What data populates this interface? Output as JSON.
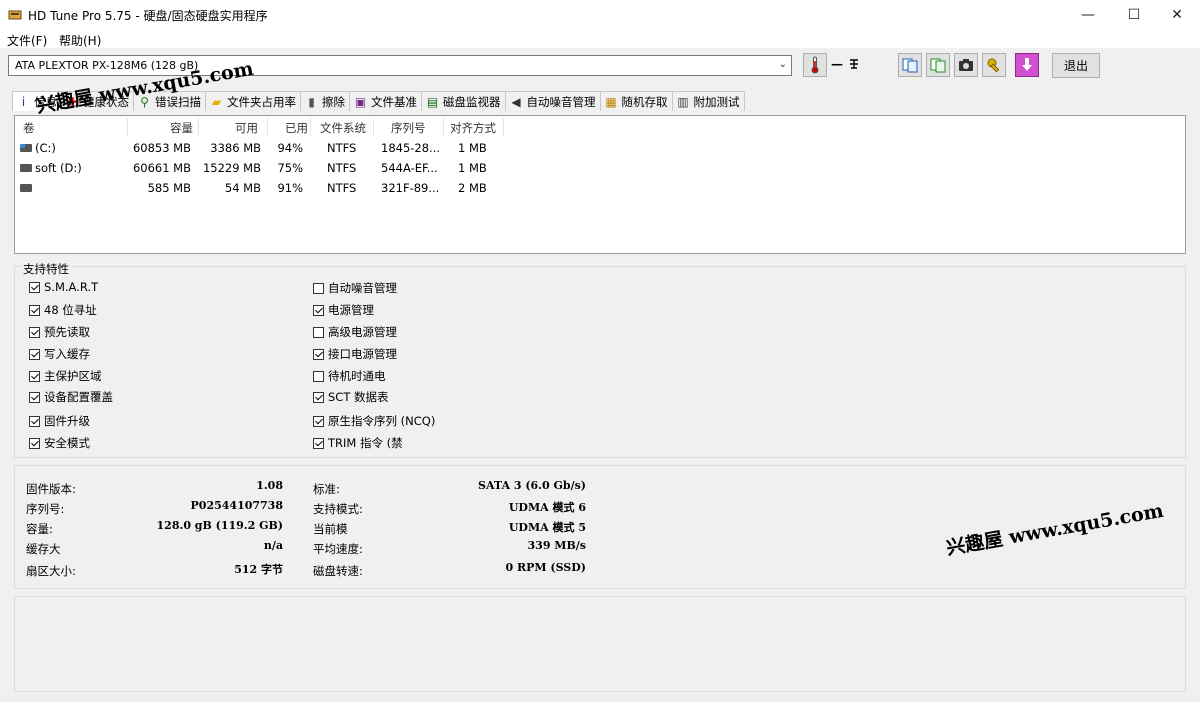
{
  "window": {
    "title": "HD Tune Pro 5.75 - 硬盘/固态硬盘实用程序",
    "min": "—",
    "max": "☐",
    "close": "✕"
  },
  "menu": {
    "file": "文件(F)",
    "help": "帮助(H)"
  },
  "toolbar": {
    "drive": "ATA    PLEXTOR PX-128M6 (128 gB)",
    "temp": "— ",
    "exit": "退出"
  },
  "tabs": [
    {
      "label": "信息",
      "icon": "info-icon"
    },
    {
      "label": "健康状态",
      "icon": "health-cross-icon"
    },
    {
      "label": "错误扫描",
      "icon": "magnifier-icon"
    },
    {
      "label": "文件夹占用率",
      "icon": "folder-icon"
    },
    {
      "label": "擦除",
      "icon": "trash-icon"
    },
    {
      "label": "文件基准",
      "icon": "file-benchmark-icon"
    },
    {
      "label": "磁盘监视器",
      "icon": "disk-monitor-icon"
    },
    {
      "label": "自动噪音管理",
      "icon": "speaker-icon"
    },
    {
      "label": "随机存取",
      "icon": "random-access-icon"
    },
    {
      "label": "附加测试",
      "icon": "extra-tests-icon"
    }
  ],
  "volumes": {
    "headers": [
      "卷",
      "容量",
      "可用",
      "已用",
      "文件系统",
      "序列号",
      "对齐方式"
    ],
    "rows": [
      {
        "name": "(C:)",
        "capacity": "60853 MB",
        "free": "3386 MB",
        "used": "94%",
        "fs": "NTFS",
        "serial": "1845-28...",
        "align": "1 MB"
      },
      {
        "name": "soft (D:)",
        "capacity": "60661 MB",
        "free": "15229 MB",
        "used": "75%",
        "fs": "NTFS",
        "serial": "544A-EF...",
        "align": "1 MB"
      },
      {
        "name": "",
        "capacity": "585 MB",
        "free": "54 MB",
        "used": "91%",
        "fs": "NTFS",
        "serial": "321F-89...",
        "align": "2 MB"
      }
    ]
  },
  "features": {
    "legend": "支持特性",
    "left": [
      {
        "label": "S.M.A.R.T",
        "checked": true
      },
      {
        "label": "48 位寻址",
        "checked": true
      },
      {
        "label": "预先读取",
        "checked": true
      },
      {
        "label": "写入缓存",
        "checked": true
      },
      {
        "label": "主保护区域",
        "checked": true
      },
      {
        "label": "设备配置覆盖",
        "checked": true
      },
      {
        "label": "固件升级",
        "checked": true
      },
      {
        "label": "安全模式",
        "checked": true
      }
    ],
    "right": [
      {
        "label": "自动噪音管理",
        "checked": false
      },
      {
        "label": "电源管理",
        "checked": true
      },
      {
        "label": "高级电源管理",
        "checked": false
      },
      {
        "label": "接口电源管理",
        "checked": true
      },
      {
        "label": "待机时通电",
        "checked": false
      },
      {
        "label": "SCT 数据表",
        "checked": true
      },
      {
        "label": "原生指令序列 (NCQ)",
        "checked": true
      },
      {
        "label": "TRIM 指令 (禁",
        "checked": true
      }
    ]
  },
  "info": {
    "left": [
      {
        "label": "固件版本:",
        "value": "1.08"
      },
      {
        "label": "序列号:",
        "value": "P02544107738"
      },
      {
        "label": "容量:",
        "value": "128.0 gB (119.2 GB)"
      },
      {
        "label": "缓存大",
        "value": "n/a"
      },
      {
        "label": "扇区大小:",
        "value": "512 字节"
      }
    ],
    "right": [
      {
        "label": "标准:",
        "value": "SATA 3 (6.0 Gb/s)"
      },
      {
        "label": "支持模式:",
        "value": "UDMA 模式 6"
      },
      {
        "label": "当前模",
        "value": "UDMA 模式 5"
      },
      {
        "label": "平均速度:",
        "value": "339 MB/s"
      },
      {
        "label": "磁盘转速:",
        "value": "0 RPM (SSD)"
      }
    ]
  },
  "watermark": {
    "text": "兴趣屋 www.xqu5.com"
  }
}
